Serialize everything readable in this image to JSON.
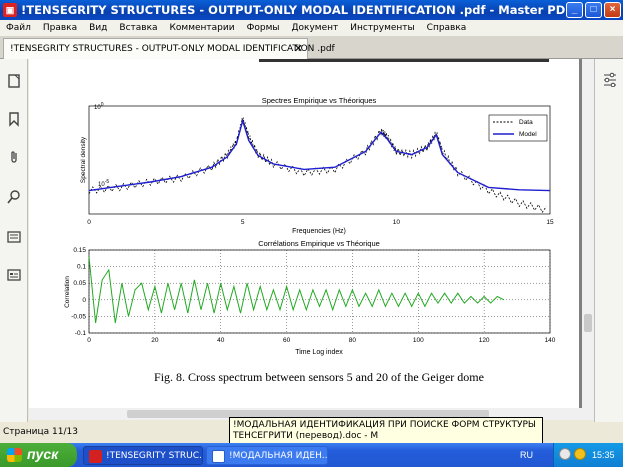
{
  "window": {
    "title": "!TENSEGRITY STRUCTURES - OUTPUT-ONLY MODAL IDENTIFICATION .pdf - Master PDF Editor (НЕЗАРЕГИСТРИРО...",
    "min": "_",
    "max": "□",
    "close": "×"
  },
  "menu": [
    "Файл",
    "Правка",
    "Вид",
    "Вставка",
    "Комментарии",
    "Формы",
    "Документ",
    "Инструменты",
    "Справка"
  ],
  "tab": {
    "label": "!TENSEGRITY STRUCTURES - OUTPUT-ONLY MODAL IDENTIFICATION .pdf"
  },
  "sidebar_icons": [
    "page-thumbnails-icon",
    "bookmarks-icon",
    "attachments-icon",
    "search-icon",
    "layers-icon",
    "forms-icon"
  ],
  "page": {
    "caption": "Fig. 8. Cross spectrum between sensors 5 and 20 of the Geiger dome"
  },
  "chart_data": [
    {
      "type": "line",
      "title": "Spectres Empirique vs Théoriques",
      "xlabel": "Frequencies (Hz)",
      "ylabel": "Spectral density",
      "xlim": [
        0,
        15
      ],
      "ylim_log": [
        1e-06,
        1
      ],
      "y_scale": "log",
      "xticks": [
        "0",
        "5",
        "10",
        "15"
      ],
      "yticks": [
        "10^0",
        "10^-5"
      ],
      "legend": [
        "Data",
        "Model"
      ],
      "legend_position": "top-right",
      "series": [
        {
          "name": "Data",
          "color": "#000000",
          "style": "dashed",
          "x": [
            0,
            1,
            2,
            3,
            4,
            4.5,
            4.8,
            5.0,
            5.2,
            5.5,
            6,
            7,
            8,
            9,
            9.5,
            9.7,
            10,
            10.5,
            11,
            11.3,
            11.5,
            12,
            13,
            14,
            15
          ],
          "y": [
            2e-05,
            3e-05,
            6e-05,
            0.0001,
            0.0004,
            0.002,
            0.01,
            0.2,
            0.02,
            0.002,
            0.0006,
            0.0002,
            0.0003,
            0.003,
            0.04,
            0.02,
            0.003,
            0.002,
            0.005,
            0.03,
            0.003,
            0.0002,
            2e-05,
            4e-06,
            1.5e-06
          ]
        },
        {
          "name": "Model",
          "color": "#1f1fd0",
          "style": "solid",
          "x": [
            0,
            1,
            2,
            3,
            4,
            4.5,
            4.8,
            5.0,
            5.2,
            5.5,
            6,
            7,
            8,
            9,
            9.5,
            9.7,
            10,
            10.5,
            11,
            11.3,
            11.5,
            12,
            13,
            14,
            15
          ],
          "y": [
            2e-05,
            3.5e-05,
            6e-05,
            0.00012,
            0.0004,
            0.0015,
            0.008,
            0.15,
            0.012,
            0.0018,
            0.0006,
            0.0003,
            0.0004,
            0.003,
            0.035,
            0.015,
            0.003,
            0.002,
            0.005,
            0.025,
            0.002,
            0.0002,
            3e-05,
            2.2e-05,
            2e-05
          ]
        }
      ]
    },
    {
      "type": "line",
      "title": "Corrélations Empirique vs Théorique",
      "xlabel": "Time Log index",
      "ylabel": "Correlation",
      "xlim": [
        0,
        140
      ],
      "ylim": [
        -0.1,
        0.15
      ],
      "xticks": [
        "0",
        "20",
        "40",
        "60",
        "80",
        "100",
        "120",
        "140"
      ],
      "yticks": [
        "-0.1",
        "-0.05",
        "0",
        "0.05",
        "0.1",
        "0.15"
      ],
      "grid": true,
      "series": [
        {
          "name": "",
          "color": "#22aa22",
          "style": "mixed",
          "x": [
            0,
            2,
            4,
            6,
            8,
            10,
            12,
            14,
            16,
            18,
            20,
            22,
            24,
            26,
            28,
            30,
            32,
            34,
            36,
            38,
            40,
            42,
            44,
            46,
            48,
            50,
            52,
            54,
            56,
            58,
            60,
            62,
            64,
            66,
            68,
            70,
            72,
            74,
            76,
            78,
            80,
            82,
            84,
            86,
            88,
            90,
            92,
            94,
            96,
            98,
            100,
            102,
            104,
            106,
            108,
            110,
            112,
            114,
            116,
            118,
            120,
            122,
            124,
            126
          ],
          "y": [
            0.13,
            -0.07,
            0.06,
            0.09,
            -0.07,
            0.05,
            -0.05,
            0.03,
            0.05,
            -0.03,
            0.04,
            -0.04,
            0.05,
            -0.03,
            0.05,
            -0.04,
            0.06,
            -0.03,
            0.05,
            -0.04,
            0.05,
            -0.03,
            0.04,
            -0.04,
            0.05,
            -0.03,
            0.04,
            -0.03,
            0.03,
            -0.03,
            0.04,
            -0.03,
            0.03,
            -0.03,
            0.03,
            -0.02,
            0.03,
            -0.03,
            0.03,
            -0.02,
            0.03,
            -0.02,
            0.02,
            -0.02,
            0.03,
            -0.02,
            0.02,
            -0.02,
            0.02,
            -0.02,
            0.02,
            -0.02,
            0.02,
            -0.01,
            0.02,
            -0.01,
            0.02,
            -0.01,
            0.01,
            -0.01,
            0.01,
            -0.01,
            0.01,
            0
          ]
        }
      ]
    }
  ],
  "status": {
    "page": "Страница 11/13"
  },
  "tooltip": {
    "text": "!МОДАЛЬНАЯ ИДЕНТИФИКАЦИЯ ПРИ ПОИСКЕ ФОРМ СТРУКТУРЫ ТЕНСЕГРИТИ (перевод).doc - M"
  },
  "taskbar": {
    "start": "пуск",
    "items": [
      {
        "label": "!TENSEGRITY STRUC...",
        "color": "#d32020"
      },
      {
        "label": "!МОДАЛЬНАЯ ИДЕН...",
        "color": "#2b5fc7"
      }
    ],
    "lang": "RU",
    "clock": "15:35"
  }
}
